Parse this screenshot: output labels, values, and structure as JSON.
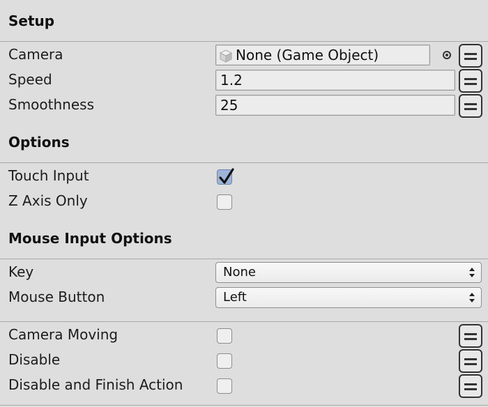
{
  "setup": {
    "title": "Setup",
    "camera": {
      "label": "Camera",
      "value": "None (Game Object)"
    },
    "speed": {
      "label": "Speed",
      "value": "1.2"
    },
    "smoothness": {
      "label": "Smoothness",
      "value": "25"
    }
  },
  "options": {
    "title": "Options",
    "touch_input": {
      "label": "Touch Input",
      "checked": true
    },
    "z_axis_only": {
      "label": "Z Axis Only",
      "checked": false
    }
  },
  "mouse_options": {
    "title": "Mouse Input Options",
    "key": {
      "label": "Key",
      "value": "None"
    },
    "mouse_button": {
      "label": "Mouse Button",
      "value": "Left"
    }
  },
  "events": {
    "camera_moving": {
      "label": "Camera Moving",
      "checked": false
    },
    "disable": {
      "label": "Disable",
      "checked": false
    },
    "disable_finish": {
      "label": "Disable and Finish Action",
      "checked": false
    }
  },
  "icons": {
    "object_picker": "target-icon",
    "menu": "menu-icon",
    "gameobject": "cube-icon",
    "dropdown": "up-down-arrows-icon",
    "check": "checkmark-icon"
  }
}
